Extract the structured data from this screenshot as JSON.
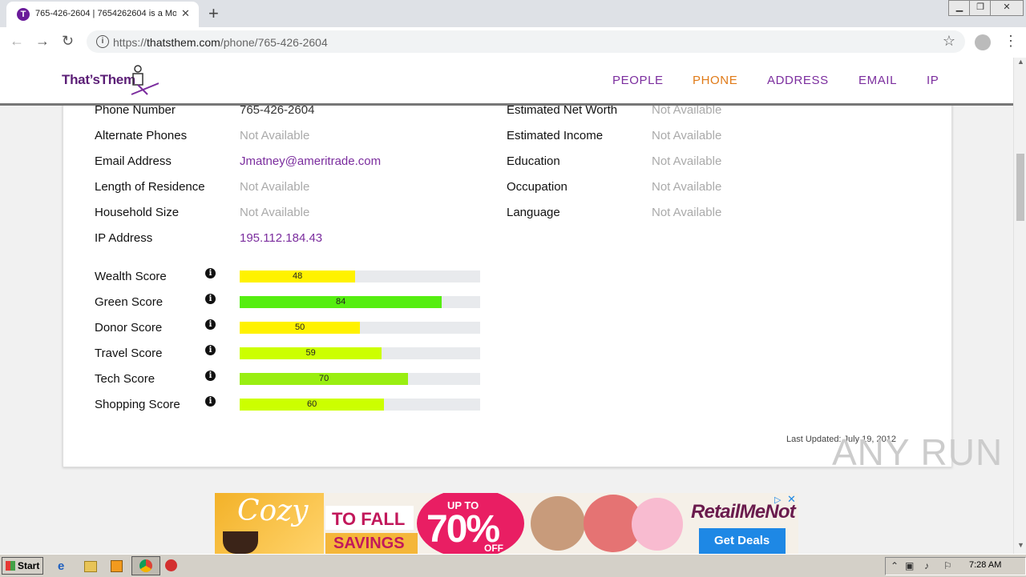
{
  "browser": {
    "tab_title": "765-426-2604 | 7654262604 is a Mo",
    "url_prefix": "https://",
    "url_domain": "thatsthem.com",
    "url_path": "/phone/765-426-2604"
  },
  "site": {
    "logo": "That’sThem",
    "nav": [
      {
        "label": "PEOPLE",
        "active": false
      },
      {
        "label": "PHONE",
        "active": true
      },
      {
        "label": "ADDRESS",
        "active": false
      },
      {
        "label": "EMAIL",
        "active": false
      },
      {
        "label": "IP",
        "active": false
      }
    ]
  },
  "details_left": [
    {
      "label": "Phone Number",
      "value": "765-426-2604"
    },
    {
      "label": "Alternate Phones",
      "value": "Not Available"
    },
    {
      "label": "Email Address",
      "value": "Jmatney@ameritrade.com"
    },
    {
      "label": "Length of Residence",
      "value": "Not Available"
    },
    {
      "label": "Household Size",
      "value": "Not Available"
    },
    {
      "label": "IP Address",
      "value": "195.112.184.43"
    }
  ],
  "details_right": [
    {
      "label": "Estimated Net Worth",
      "value": "Not Available"
    },
    {
      "label": "Estimated Income",
      "value": "Not Available"
    },
    {
      "label": "Education",
      "value": "Not Available"
    },
    {
      "label": "Occupation",
      "value": "Not Available"
    },
    {
      "label": "Language",
      "value": "Not Available"
    }
  ],
  "scores": [
    {
      "label": "Wealth Score",
      "value": 48,
      "color": "#fff200"
    },
    {
      "label": "Green Score",
      "value": 84,
      "color": "#55ee11"
    },
    {
      "label": "Donor Score",
      "value": 50,
      "color": "#fff200"
    },
    {
      "label": "Travel Score",
      "value": 59,
      "color": "#ccff00"
    },
    {
      "label": "Tech Score",
      "value": 70,
      "color": "#99ee11"
    },
    {
      "label": "Shopping Score",
      "value": 60,
      "color": "#ccff00"
    }
  ],
  "last_updated": "Last Updated: July 19, 2012",
  "ad": {
    "cozy": "Cozy",
    "to_fall": "TO FALL",
    "savings": "SAVINGS",
    "up_to": "UP TO",
    "percent": "70%",
    "off": "OFF",
    "brand": "RetailMeNot",
    "cta": "Get Deals"
  },
  "watermark": "ANY RUN",
  "taskbar": {
    "start": "Start",
    "clock": "7:28 AM"
  }
}
